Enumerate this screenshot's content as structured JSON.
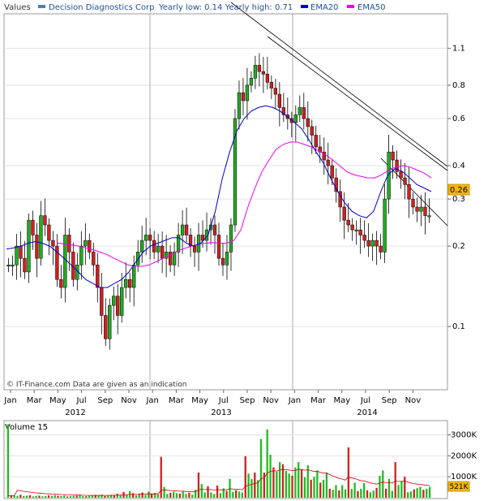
{
  "price_panel": {
    "values_label": "Values",
    "legend": [
      {
        "name": "Decision Diagnostics Corp",
        "color": "#4682b4"
      },
      {
        "name": "EMA20",
        "color": "#0000cc"
      },
      {
        "name": "EMA50",
        "color": "#ee00ee"
      }
    ],
    "yearly_text": "Yearly low: 0.14 Yearly high: 0.71",
    "last_price_label": "0.26",
    "watermark": "© IT-Finance.com Data are given as an indication"
  },
  "volume_panel": {
    "title": "Volume 15",
    "last_volume_label": "521K"
  },
  "chart_data": {
    "type": "candlestick",
    "y_scale": "log",
    "price_ticks": [
      "1.1",
      "0.8",
      "0.6",
      "0.4",
      "0.3",
      "0.2",
      "0.1"
    ],
    "price_tick_values": [
      1.1,
      0.8,
      0.6,
      0.4,
      0.3,
      0.2,
      0.1
    ],
    "volume_ticks": [
      "3000K",
      "2000K",
      "1000K"
    ],
    "volume_tick_values": [
      3000,
      2000,
      1000
    ],
    "x_month_ticks": [
      "Jan",
      "Mar",
      "May",
      "Jul",
      "Sep",
      "Nov",
      "Jan",
      "Mar",
      "May",
      "Jul",
      "Sep",
      "Nov",
      "Jan",
      "Mar",
      "May",
      "Jul",
      "Sep",
      "Nov"
    ],
    "x_years": [
      "2012",
      "2013",
      "2014"
    ],
    "last_price": 0.26,
    "last_volume_k": 521,
    "price_series": [
      0.17,
      0.17,
      0.2,
      0.18,
      0.16,
      0.25,
      0.22,
      0.18,
      0.26,
      0.24,
      0.21,
      0.2,
      0.15,
      0.14,
      0.22,
      0.19,
      0.15,
      0.17,
      0.2,
      0.21,
      0.19,
      0.17,
      0.14,
      0.11,
      0.09,
      0.12,
      0.13,
      0.11,
      0.14,
      0.15,
      0.14,
      0.17,
      0.19,
      0.21,
      0.22,
      0.21,
      0.19,
      0.2,
      0.18,
      0.19,
      0.17,
      0.19,
      0.22,
      0.24,
      0.22,
      0.2,
      0.19,
      0.22,
      0.21,
      0.23,
      0.24,
      0.22,
      0.18,
      0.17,
      0.19,
      0.24,
      0.6,
      0.75,
      0.7,
      0.8,
      0.85,
      0.95,
      0.9,
      0.88,
      0.82,
      0.78,
      0.74,
      0.66,
      0.62,
      0.6,
      0.58,
      0.62,
      0.66,
      0.6,
      0.56,
      0.52,
      0.47,
      0.45,
      0.42,
      0.4,
      0.36,
      0.32,
      0.28,
      0.25,
      0.24,
      0.23,
      0.23,
      0.22,
      0.21,
      0.2,
      0.21,
      0.2,
      0.19,
      0.3,
      0.45,
      0.42,
      0.38,
      0.36,
      0.34,
      0.3,
      0.28,
      0.27,
      0.28,
      0.26,
      0.26
    ],
    "candle_colors": [
      "g",
      "r"
    ],
    "ema20": [
      0.195,
      0.197,
      0.2,
      0.205,
      0.208,
      0.205,
      0.2,
      0.19,
      0.18,
      0.17,
      0.16,
      0.15,
      0.145,
      0.14,
      0.14,
      0.145,
      0.15,
      0.16,
      0.175,
      0.19,
      0.2,
      0.205,
      0.21,
      0.215,
      0.215,
      0.205,
      0.2,
      0.205,
      0.22,
      0.27,
      0.36,
      0.45,
      0.54,
      0.6,
      0.64,
      0.66,
      0.67,
      0.66,
      0.64,
      0.61,
      0.58,
      0.55,
      0.5,
      0.45,
      0.41,
      0.36,
      0.32,
      0.29,
      0.27,
      0.26,
      0.255,
      0.27,
      0.32,
      0.37,
      0.39,
      0.38,
      0.36,
      0.34,
      0.33,
      0.32
    ],
    "ema50": [
      0.205,
      0.204,
      0.202,
      0.2,
      0.197,
      0.194,
      0.19,
      0.186,
      0.18,
      0.175,
      0.17,
      0.168,
      0.168,
      0.17,
      0.175,
      0.18,
      0.185,
      0.192,
      0.196,
      0.2,
      0.203,
      0.205,
      0.206,
      0.205,
      0.205,
      0.21,
      0.23,
      0.28,
      0.33,
      0.38,
      0.42,
      0.46,
      0.48,
      0.49,
      0.49,
      0.48,
      0.47,
      0.455,
      0.44,
      0.42,
      0.4,
      0.38,
      0.37,
      0.365,
      0.36,
      0.36,
      0.37,
      0.385,
      0.395,
      0.4,
      0.395,
      0.385,
      0.375,
      0.36
    ],
    "volume_k": [
      3500,
      110,
      100,
      90,
      140,
      80,
      100,
      120,
      60,
      90,
      100,
      70,
      80,
      110,
      90,
      130,
      90,
      80,
      110,
      60,
      80,
      90,
      100,
      120,
      80,
      70,
      90,
      110,
      130,
      100,
      150,
      80,
      110,
      140,
      120,
      200,
      110,
      280,
      150,
      310,
      220,
      120,
      200,
      250,
      140,
      290,
      180,
      230,
      160,
      1950,
      520,
      180,
      240,
      280,
      220,
      200,
      300,
      180,
      240,
      150,
      380,
      1200,
      650,
      250,
      550,
      250,
      180,
      580,
      220,
      450,
      320,
      900,
      280,
      360,
      300,
      250,
      1980,
      1150,
      900,
      1200,
      840,
      2800,
      1200,
      3250,
      2050,
      1450,
      1250,
      1700,
      1600,
      1280,
      1150,
      1050,
      1450,
      1700,
      1350,
      980,
      1550,
      860,
      1000,
      1300,
      720,
      850,
      1200,
      430,
      380,
      600,
      350,
      600,
      400,
      2400,
      420,
      720,
      320,
      420,
      700,
      360,
      260,
      340,
      470,
      1050,
      1300,
      430,
      900,
      330,
      1700,
      600,
      800,
      1000,
      260,
      300,
      400,
      460,
      520,
      380,
      420,
      521
    ]
  }
}
